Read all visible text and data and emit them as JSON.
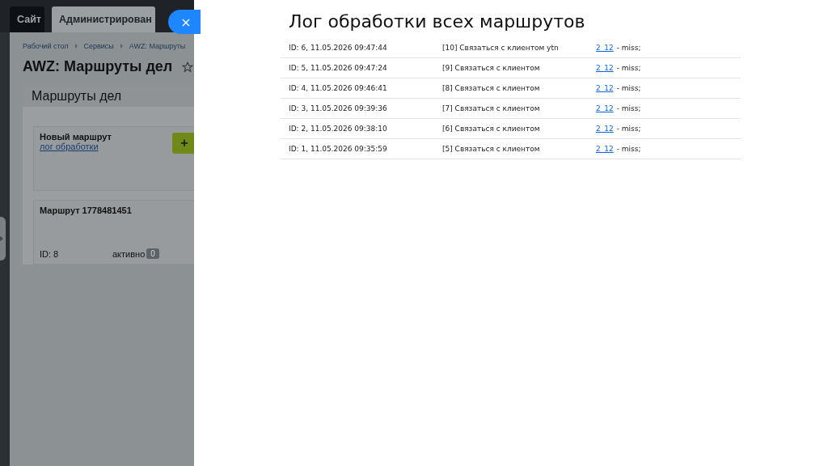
{
  "background_page": {
    "tabs": [
      {
        "label": "Сайт",
        "selected": false
      },
      {
        "label": "Администрирован",
        "selected": true
      }
    ],
    "breadcrumbs": [
      "Рабочий стол",
      "Сервисы",
      "AWZ: Маршруты"
    ],
    "title": "AWZ: Маршруты дел",
    "panel": {
      "title": "Маршруты дел",
      "new_route": {
        "title": "Новый маршрут",
        "link": "лог обработки",
        "add_button": "+"
      },
      "routes": [
        {
          "title": "Маршрут 1778481451",
          "id": "ID: 8",
          "status": "активно",
          "count": "0"
        }
      ]
    }
  },
  "close_button": "×",
  "slider": {
    "title": "Лог обработки всех маршрутов",
    "rows": [
      {
        "id": "ID: 6, 11.05.2026 09:47:44",
        "action": "[10] Связаться с клиентом ytn",
        "link": "2_12",
        "result": "- miss;"
      },
      {
        "id": "ID: 5, 11.05.2026 09:47:24",
        "action": "[9] Связаться с клиентом",
        "link": "2_12",
        "result": "- miss;"
      },
      {
        "id": "ID: 4, 11.05.2026 09:46:41",
        "action": "[8] Связаться с клиентом",
        "link": "2_12",
        "result": "- miss;"
      },
      {
        "id": "ID: 3, 11.05.2026 09:39:36",
        "action": "[7] Связаться с клиентом",
        "link": "2_12",
        "result": "- miss;"
      },
      {
        "id": "ID: 2, 11.05.2026 09:38:10",
        "action": "[6] Связаться с клиентом",
        "link": "2_12",
        "result": "- miss;"
      },
      {
        "id": "ID: 1, 11.05.2026 09:35:59",
        "action": "[5] Связаться с клиентом",
        "link": "2_12",
        "result": "- miss;"
      }
    ]
  }
}
